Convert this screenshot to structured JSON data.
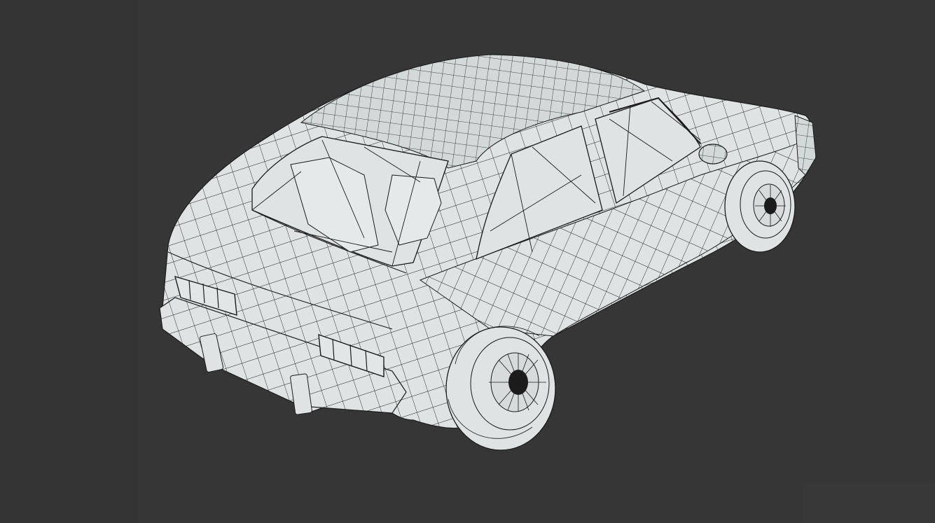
{
  "viewport": {
    "background_color": "#363636",
    "mesh_fill_color": "#dfe3e3",
    "wire_color": "#1c1c1c",
    "display_mode": "wireframe-on-shaded",
    "model": "hatchback-car"
  }
}
